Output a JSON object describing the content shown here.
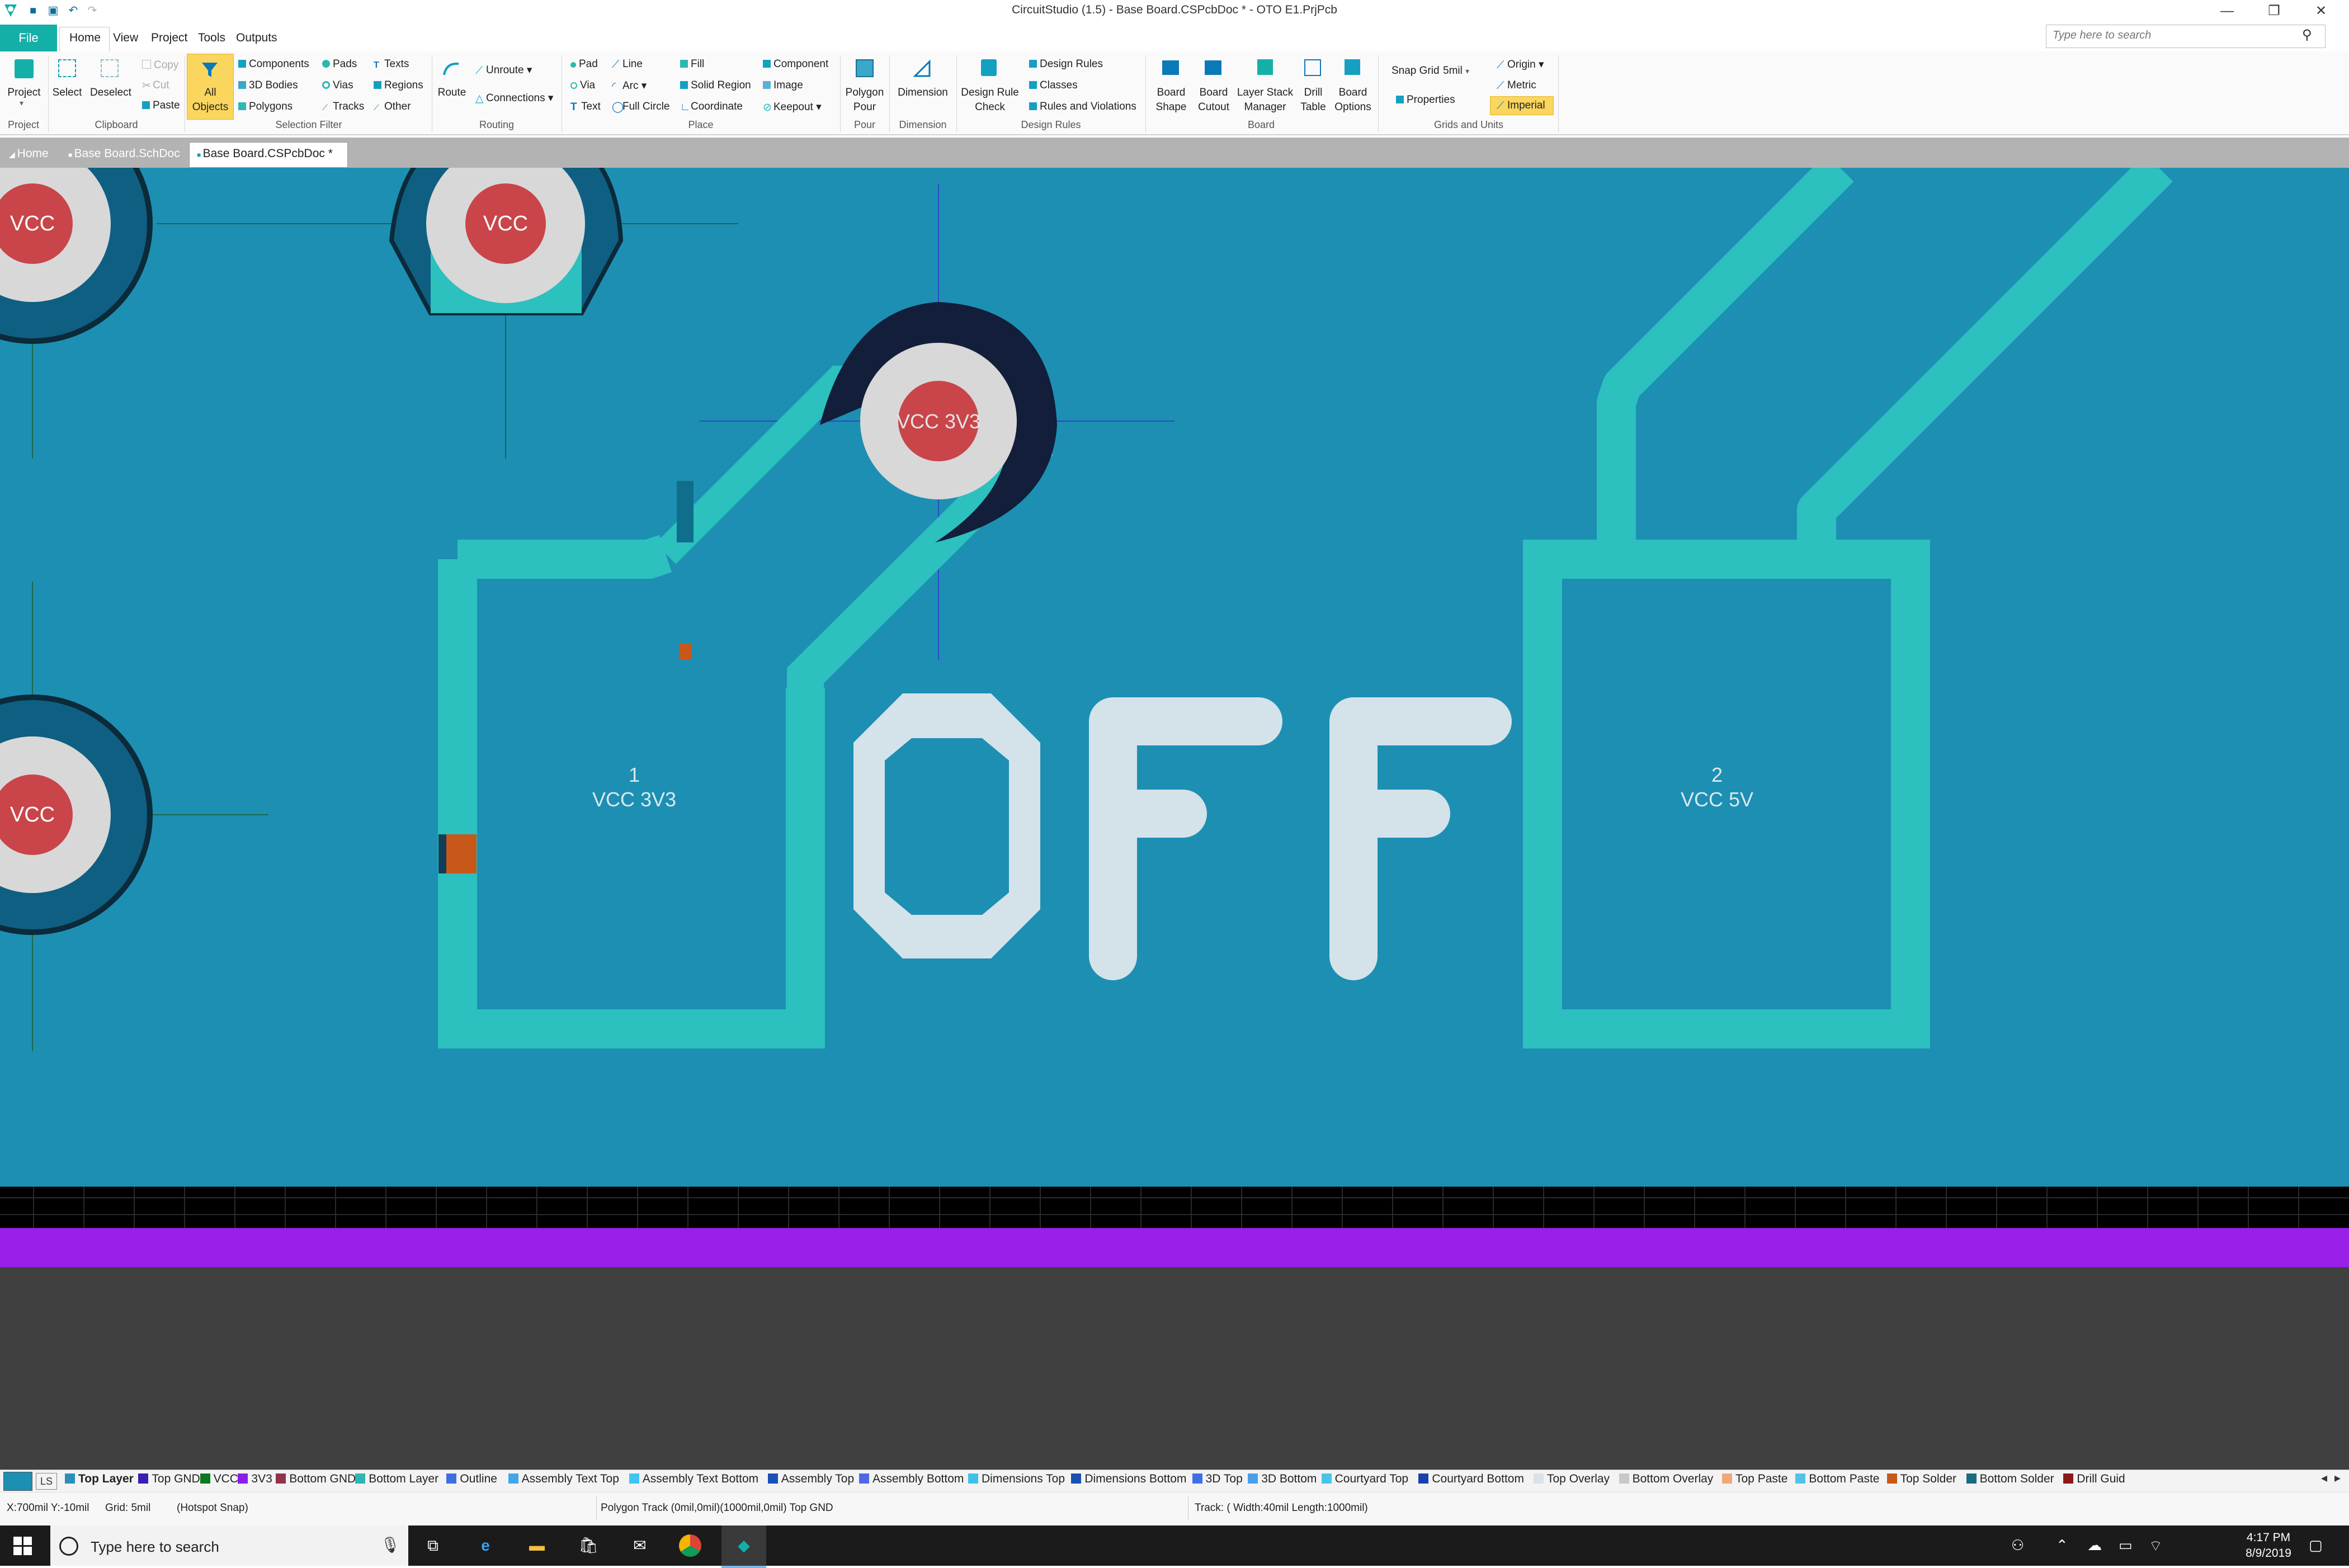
{
  "window": {
    "title": "CircuitStudio (1.5) - Base Board.CSPcbDoc * - OTO E1.PrjPcb",
    "minimize": "—",
    "restore": "❐",
    "close": "✕"
  },
  "menu": {
    "file": "File",
    "tabs": [
      "Home",
      "View",
      "Project",
      "Tools",
      "Outputs"
    ],
    "search_placeholder": "Type here to search"
  },
  "ribbon": {
    "project": {
      "label": "Project",
      "group": "Project"
    },
    "clipboard": {
      "select": "Select",
      "deselect": "Deselect",
      "copy": "Copy",
      "cut": "Cut",
      "paste": "Paste",
      "group": "Clipboard"
    },
    "selection_filter": {
      "all_objects_line1": "All",
      "all_objects_line2": "Objects",
      "items": [
        "Components",
        "3D Bodies",
        "Polygons",
        "Pads",
        "Vias",
        "Tracks",
        "Texts",
        "Regions",
        "Other"
      ],
      "group": "Selection Filter"
    },
    "routing": {
      "route": "Route",
      "unroute": "Unroute",
      "connections": "Connections",
      "group": "Routing"
    },
    "place": {
      "items": [
        "Pad",
        "Via",
        "Text",
        "Line",
        "Arc",
        "Full Circle",
        "Fill",
        "Solid Region",
        "Coordinate",
        "Component",
        "Image",
        "Keepout"
      ],
      "group": "Place"
    },
    "pour": {
      "line1": "Polygon",
      "line2": "Pour",
      "group": "Pour"
    },
    "dimension": {
      "label": "Dimension",
      "group": "Dimension"
    },
    "design_rules": {
      "drc_line1": "Design Rule",
      "drc_line2": "Check",
      "rules": "Design Rules",
      "classes": "Classes",
      "violations": "Rules and Violations",
      "group": "Design Rules"
    },
    "board": {
      "shape_line1": "Board",
      "shape_line2": "Shape",
      "cutout_line1": "Board",
      "cutout_line2": "Cutout",
      "lsm_line1": "Layer Stack",
      "lsm_line2": "Manager",
      "drill_line1": "Drill",
      "drill_line2": "Table",
      "options_line1": "Board",
      "options_line2": "Options",
      "group": "Board"
    },
    "grids": {
      "snap_label": "Snap Grid",
      "snap_value": "5mil",
      "properties": "Properties",
      "origin": "Origin",
      "metric": "Metric",
      "imperial": "Imperial",
      "group": "Grids and Units"
    }
  },
  "doc_tabs": [
    "Home",
    "Base Board.SchDoc",
    "Base Board.CSPcbDoc *"
  ],
  "pcb": {
    "pad_labels": {
      "vcc_a": "VCC",
      "vcc_b": "VCC",
      "vcc_c": "VCC",
      "vcc_3v3": "VCC 3V3"
    },
    "pad1_number": "1",
    "pad1_net": "VCC 3V3",
    "pad2_number": "2",
    "pad2_net": "VCC 5V",
    "silk_text": "OFF",
    "colors": {
      "board": "#1d8fb3",
      "copper": "#2cc0bf",
      "silk": "#d4e2ea",
      "pad_red": "#c9454a",
      "pad_ring": "#d8d8d8"
    }
  },
  "layer_tabs": {
    "ls": "LS",
    "items": [
      {
        "name": "Top Layer",
        "color": "#2a8fb8"
      },
      {
        "name": "Top GND",
        "color": "#3b1db2"
      },
      {
        "name": "VCC",
        "color": "#0b7a1f"
      },
      {
        "name": "3V3",
        "color": "#8a1ee8"
      },
      {
        "name": "Bottom GND",
        "color": "#93324a"
      },
      {
        "name": "Bottom Layer",
        "color": "#2db6b3"
      },
      {
        "name": "Outline",
        "color": "#3d6fe0"
      },
      {
        "name": "Assembly Text Top",
        "color": "#40a8e8"
      },
      {
        "name": "Assembly Text Bottom",
        "color": "#40c4f0"
      },
      {
        "name": "Assembly Top",
        "color": "#1a4fb8"
      },
      {
        "name": "Assembly Bottom",
        "color": "#5068e8"
      },
      {
        "name": "Dimensions Top",
        "color": "#40c0e8"
      },
      {
        "name": "Dimensions Bottom",
        "color": "#1a4fb0"
      },
      {
        "name": "3D Top",
        "color": "#3d70e8"
      },
      {
        "name": "3D Bottom",
        "color": "#4aa0e8"
      },
      {
        "name": "Courtyard Top",
        "color": "#48c4e8"
      },
      {
        "name": "Courtyard Bottom",
        "color": "#1a40b0"
      },
      {
        "name": "Top Overlay",
        "color": "#d9e2e8"
      },
      {
        "name": "Bottom Overlay",
        "color": "#c8c8c8"
      },
      {
        "name": "Top Paste",
        "color": "#f0a878"
      },
      {
        "name": "Bottom Paste",
        "color": "#50c4e8"
      },
      {
        "name": "Top Solder",
        "color": "#c8581a"
      },
      {
        "name": "Bottom Solder",
        "color": "#1a6a80"
      },
      {
        "name": "Drill Guid",
        "color": "#8a1a1a"
      }
    ]
  },
  "status": {
    "coords": "X:700mil Y:-10mil",
    "grid": "Grid: 5mil",
    "snap": "(Hotspot Snap)",
    "object": "Polygon Track (0mil,0mil)(1000mil,0mil)  Top GND",
    "track": "Track: ( Width:40mil Length:1000mil)"
  },
  "taskbar": {
    "search": "Type here to search",
    "time": "4:17 PM",
    "date": "8/9/2019"
  }
}
